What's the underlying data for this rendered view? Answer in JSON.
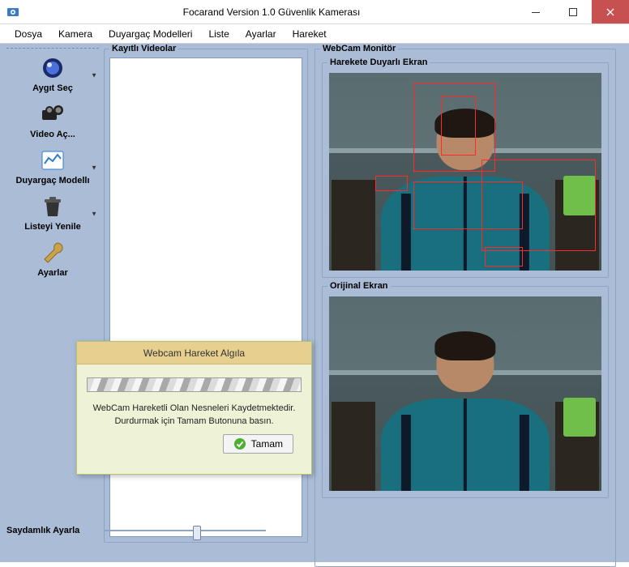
{
  "window": {
    "title": "Focarand Version 1.0 Güvenlik Kamerası"
  },
  "menu": {
    "file": "Dosya",
    "camera": "Kamera",
    "models": "Duyargaç Modelleri",
    "list": "Liste",
    "settings": "Ayarlar",
    "motion": "Hareket"
  },
  "toolbar": {
    "select_device": "Aygıt Seç",
    "open_video": "Video Aç...",
    "detector_models": "Duyargaç Modellı",
    "refresh_list": "Listeyi Yenile",
    "settings": "Ayarlar"
  },
  "groups": {
    "recorded_videos": "Kayıtlı Videolar",
    "webcam_monitor": "WebCam Monitör",
    "motion_screen": "Harekete Duyarlı Ekran",
    "original_screen": "Orijinal Ekran"
  },
  "slider": {
    "label": "Saydamlık Ayarla"
  },
  "dialog": {
    "title": "Webcam Hareket Algıla",
    "line1": "WebCam Hareketli Olan Nesneleri Kaydetmektedir.",
    "line2": "Durdurmak için Tamam Butonuna basın.",
    "ok": "Tamam"
  }
}
